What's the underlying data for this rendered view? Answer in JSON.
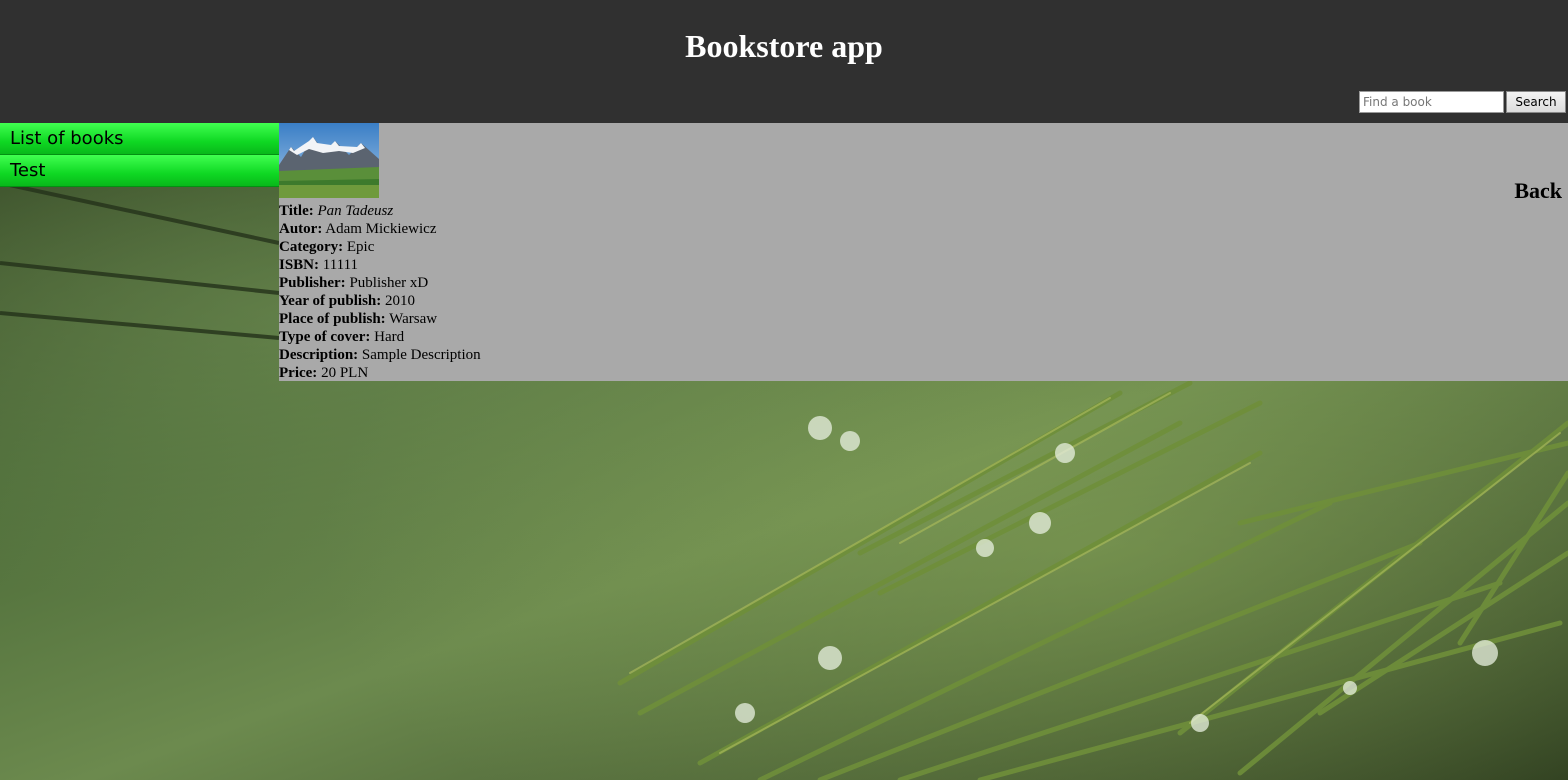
{
  "header": {
    "title": "Bookstore app"
  },
  "search": {
    "placeholder": "Find a book",
    "value": "",
    "button_label": "Search"
  },
  "sidebar": {
    "items": [
      {
        "label": "List of books"
      },
      {
        "label": "Test"
      }
    ]
  },
  "book": {
    "back_label": "Back",
    "fields": [
      {
        "label": "Title:",
        "value": "Pan Tadeusz"
      },
      {
        "label": "Autor:",
        "value": "Adam Mickiewicz"
      },
      {
        "label": "Category:",
        "value": "Epic"
      },
      {
        "label": "ISBN:",
        "value": "11111"
      },
      {
        "label": "Publisher:",
        "value": "Publisher xD"
      },
      {
        "label": "Year of publish:",
        "value": "2010"
      },
      {
        "label": "Place of publish:",
        "value": "Warsaw"
      },
      {
        "label": "Type of cover:",
        "value": "Hard"
      },
      {
        "label": "Description:",
        "value": "Sample Description"
      },
      {
        "label": "Price:",
        "value": "20 PLN"
      }
    ]
  },
  "colors": {
    "header_bg": "#303030",
    "sidebar_green": "#0fd823",
    "content_bg": "#a9a9a9"
  }
}
